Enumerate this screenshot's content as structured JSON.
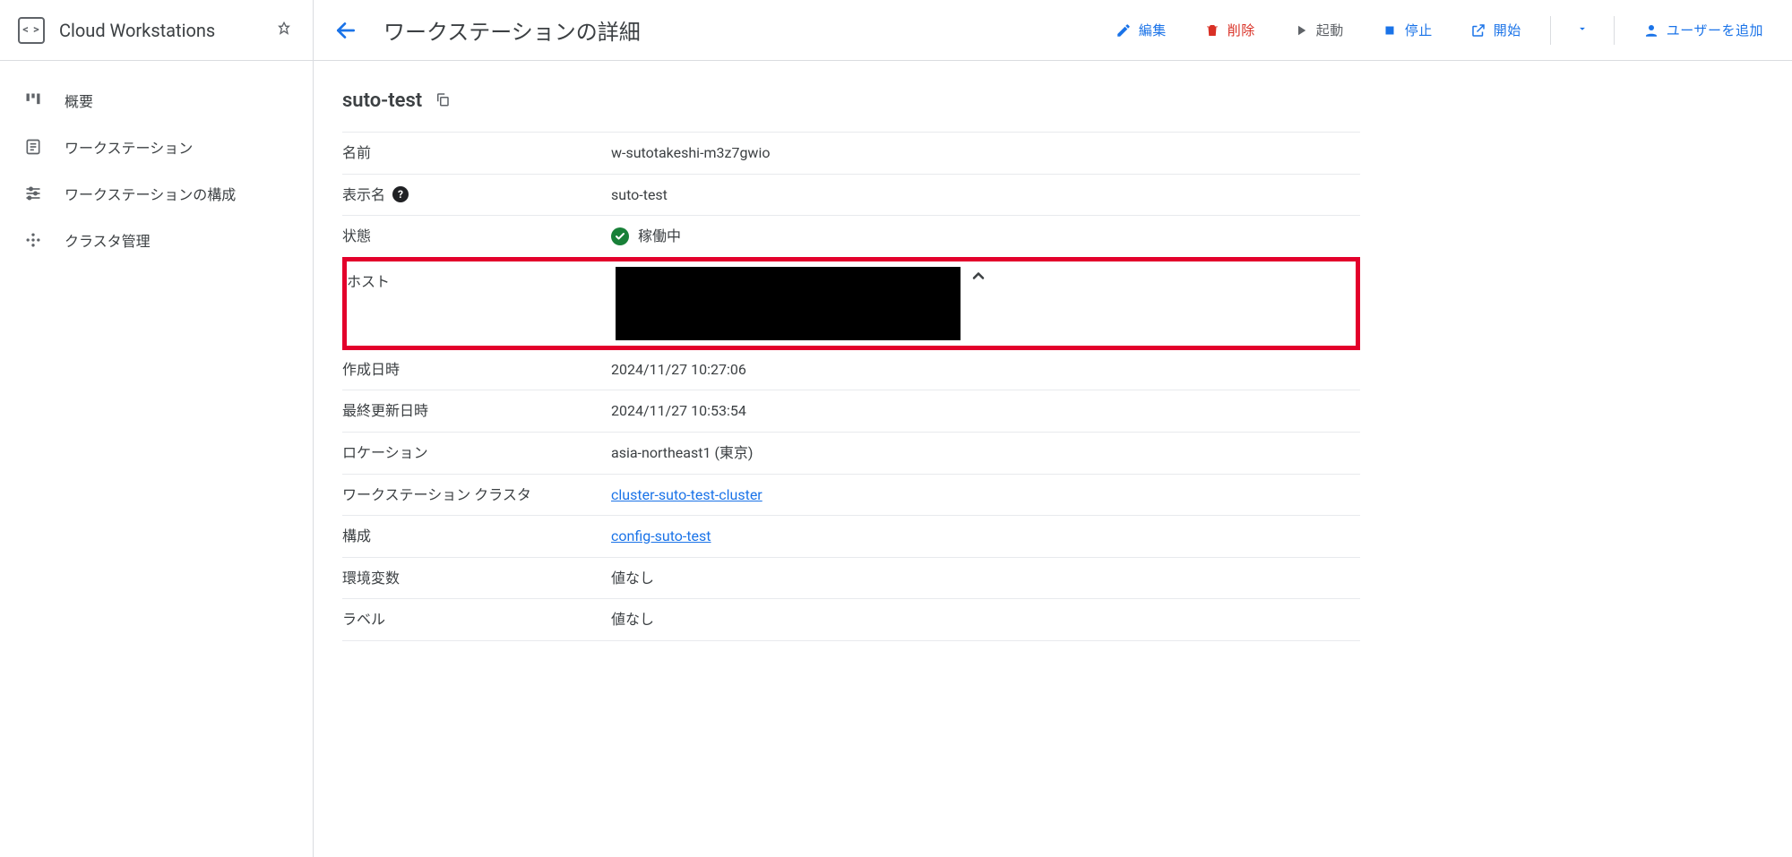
{
  "sidebar": {
    "product_title": "Cloud Workstations",
    "items": [
      {
        "label": "概要"
      },
      {
        "label": "ワークステーション"
      },
      {
        "label": "ワークステーションの構成"
      },
      {
        "label": "クラスタ管理"
      }
    ]
  },
  "topbar": {
    "page_title": "ワークステーションの詳細",
    "actions": {
      "edit": "編集",
      "delete": "削除",
      "boot": "起動",
      "stop": "停止",
      "start": "開始",
      "add_user": "ユーザーを追加"
    }
  },
  "workstation": {
    "title": "suto-test",
    "rows": {
      "name_label": "名前",
      "name_value": "w-sutotakeshi-m3z7gwio",
      "display_label": "表示名",
      "display_value": "suto-test",
      "state_label": "状態",
      "state_value": "稼働中",
      "host_label": "ホスト",
      "created_label": "作成日時",
      "created_value": "2024/11/27 10:27:06",
      "updated_label": "最終更新日時",
      "updated_value": "2024/11/27 10:53:54",
      "location_label": "ロケーション",
      "location_value": "asia-northeast1 (東京)",
      "cluster_label": "ワークステーション クラスタ",
      "cluster_value": "cluster-suto-test-cluster",
      "config_label": "構成",
      "config_value": "config-suto-test",
      "env_label": "環境変数",
      "env_value": "値なし",
      "labels_label": "ラベル",
      "labels_value": "値なし"
    }
  }
}
